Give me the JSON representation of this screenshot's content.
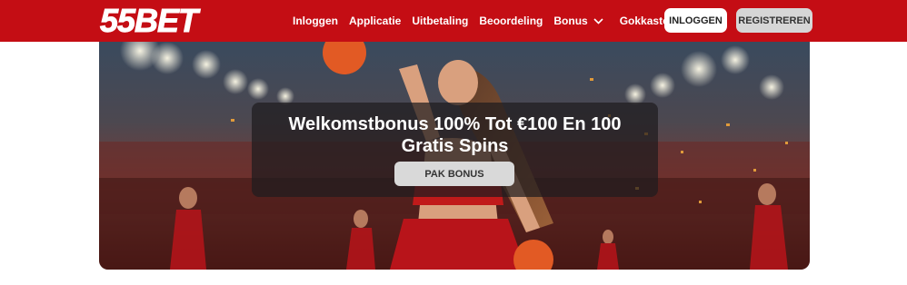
{
  "brand": {
    "logo_text": "55BET",
    "accent": "#c40d14"
  },
  "nav": {
    "items": [
      {
        "label": "Inloggen"
      },
      {
        "label": "Applicatie"
      },
      {
        "label": "Uitbetaling"
      },
      {
        "label": "Beoordeling"
      },
      {
        "label": "Bonus",
        "icon": "chevron-down-icon"
      },
      {
        "label": "Gokkasten"
      }
    ]
  },
  "auth": {
    "login_label": "INLOGGEN",
    "register_label": "REGISTREREN"
  },
  "hero": {
    "title": "Welkomstbonus 100% Tot €100 En 100 Gratis Spins",
    "cta_label": "PAK BONUS"
  }
}
